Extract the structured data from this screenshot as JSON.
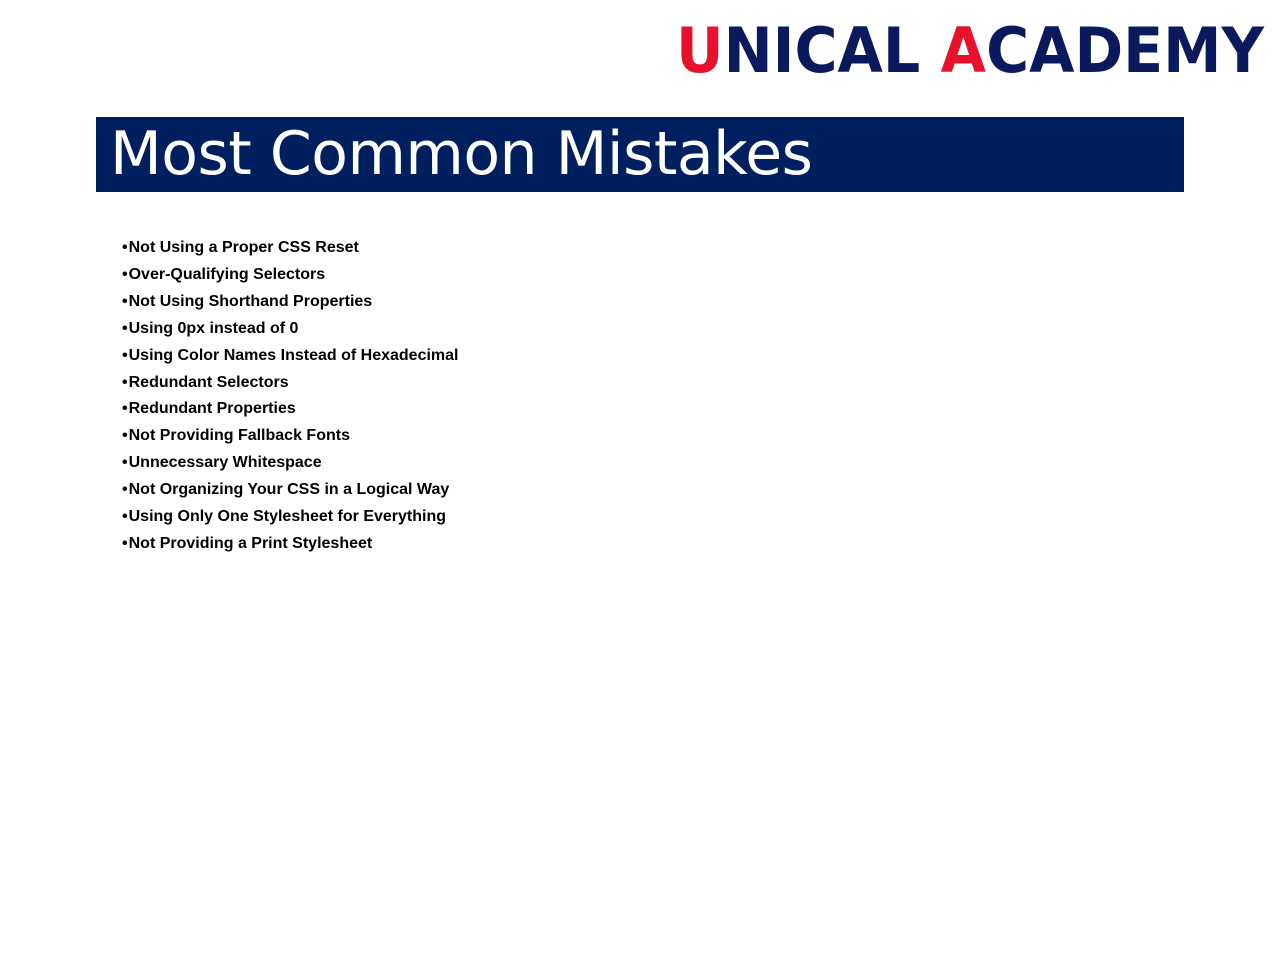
{
  "logo": {
    "text": "UNICAL ACADEMY",
    "colors": {
      "navy": "#0a1a5c",
      "red": "#e8112d"
    }
  },
  "slide": {
    "title": "Most Common Mistakes",
    "bullet_char": "•",
    "bullets": [
      "Not Using a Proper CSS Reset",
      "Over-Qualifying Selectors",
      "Not Using Shorthand Properties",
      "Using 0px instead of 0",
      "Using Color Names Instead of Hexadecimal",
      "Redundant Selectors",
      "Redundant Properties",
      "Not Providing Fallback Fonts",
      "Unnecessary Whitespace",
      "Not Organizing Your CSS in a Logical Way",
      "Using Only One Stylesheet for Everything",
      "Not Providing a Print Stylesheet"
    ]
  },
  "colors": {
    "title_bar": "#001f5f",
    "title_text": "#ffffff",
    "body_text": "#000000"
  }
}
